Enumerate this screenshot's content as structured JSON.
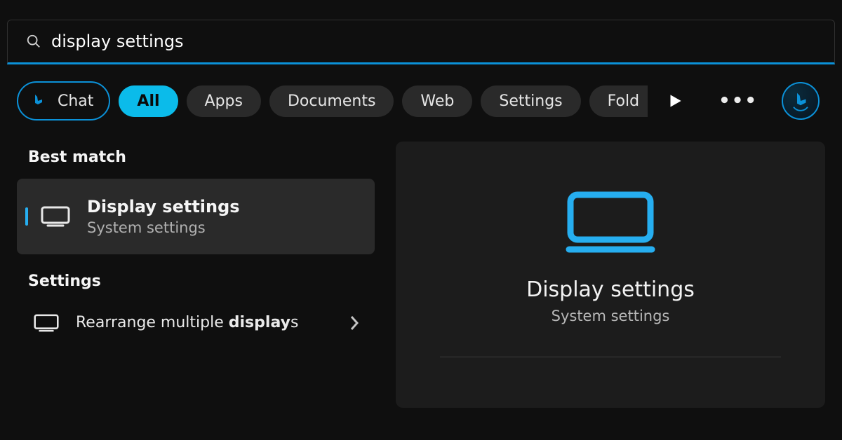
{
  "search": {
    "value": "display settings"
  },
  "filters": {
    "chat": "Chat",
    "all": "All",
    "apps": "Apps",
    "documents": "Documents",
    "web": "Web",
    "settings": "Settings",
    "folders": "Fold"
  },
  "sections": {
    "best_match": "Best match",
    "settings_label": "Settings"
  },
  "best_match": {
    "title": "Display settings",
    "subtitle": "System settings"
  },
  "settings_results": [
    {
      "prefix": "Rearrange multiple ",
      "bold": "display",
      "suffix": "s"
    }
  ],
  "preview": {
    "title": "Display settings",
    "subtitle": "System settings"
  },
  "colors": {
    "accent": "#26aef0"
  }
}
